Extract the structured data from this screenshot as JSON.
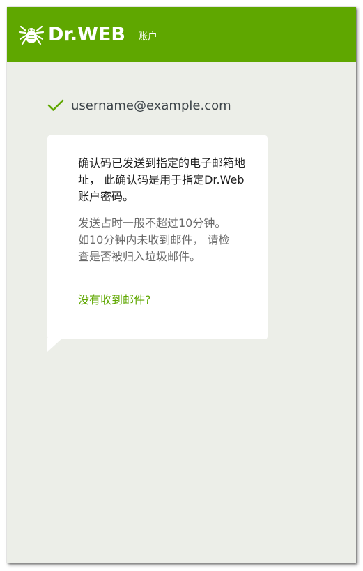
{
  "header": {
    "brand": "Dr.WEB",
    "subtitle": "账户",
    "logo_icon": "spider-logo-icon",
    "background_color": "#5fa700"
  },
  "account": {
    "check_icon": "checkmark-icon",
    "email": "username@example.com"
  },
  "message": {
    "primary": "确认码已发送到指定的电子邮箱地址， 此确认码是用于指定Dr.Web账户密码。",
    "secondary": "发送占时一般不超过10分钟。 如10分钟内未收到邮件， 请检查是否被归入垃圾邮件。",
    "link_label": "没有收到邮件?"
  },
  "colors": {
    "accent": "#5fa700",
    "page_background": "#eceee8",
    "bubble_background": "#ffffff"
  }
}
